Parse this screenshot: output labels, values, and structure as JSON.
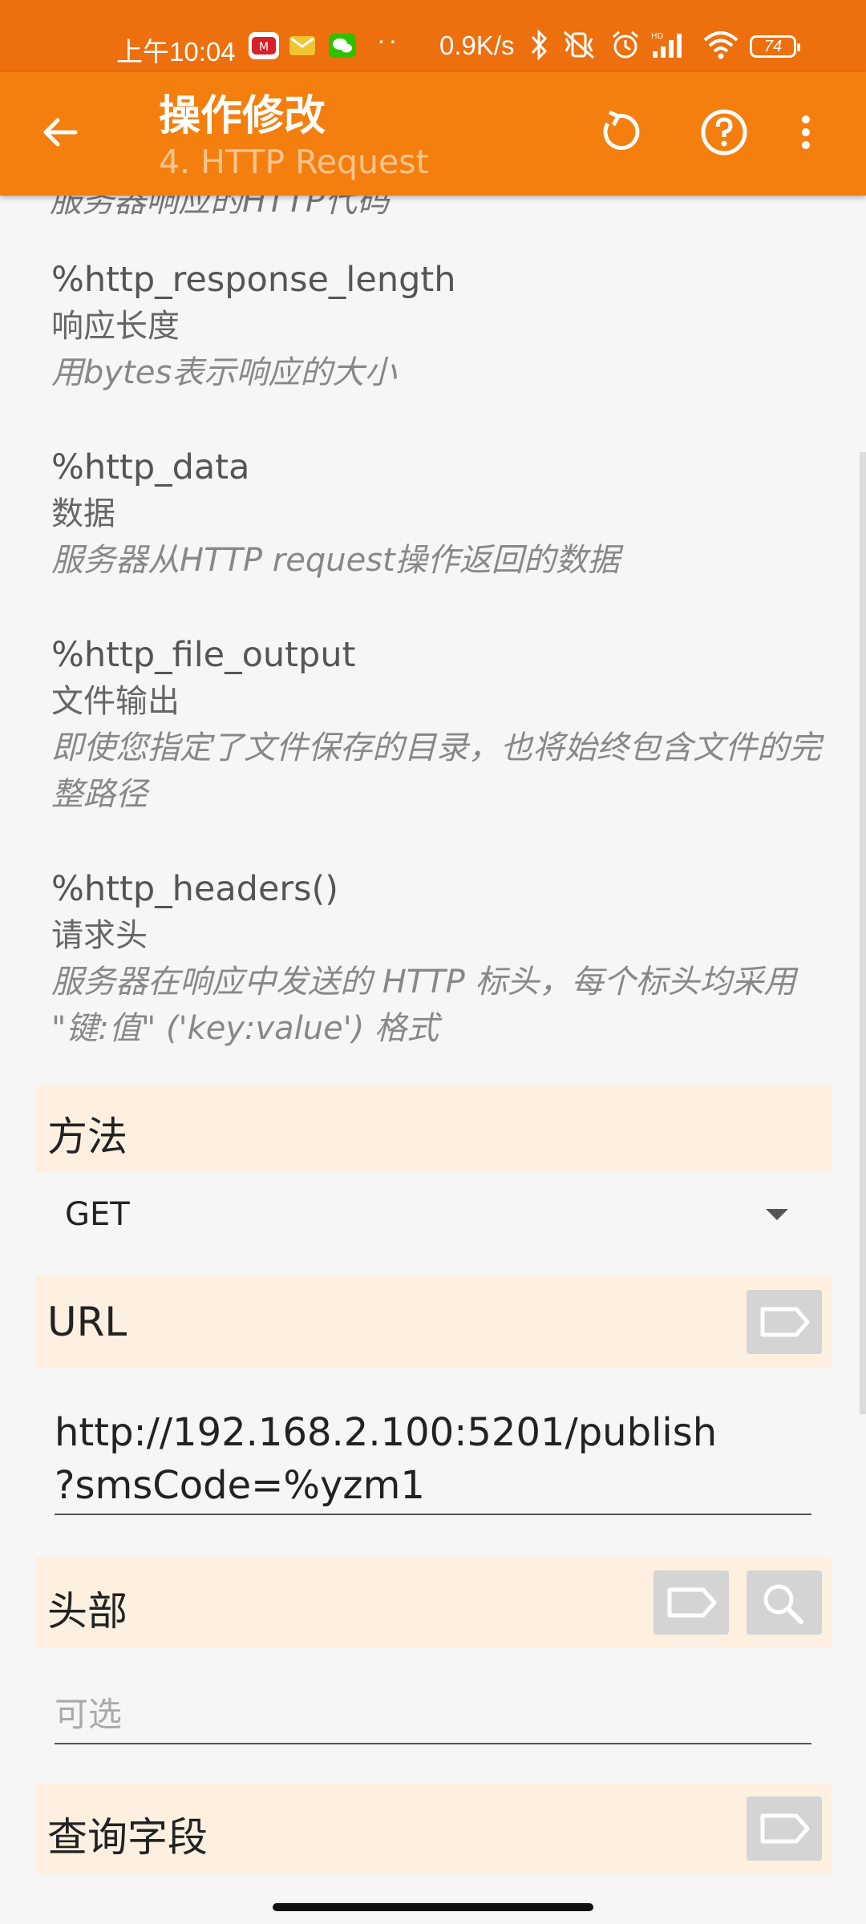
{
  "status_bar": {
    "time": "上午10:04",
    "net_speed": "0.9K/s",
    "dots": "··",
    "battery": "74"
  },
  "app_bar": {
    "title": "操作修改",
    "subtitle": "4. HTTP Request"
  },
  "variables": [
    {
      "clipped": "服务器响应的HTTP代码"
    },
    {
      "name": "%http_response_length",
      "label": "响应长度",
      "desc": "用bytes表示响应的大小"
    },
    {
      "name": "%http_data",
      "label": "数据",
      "desc": "服务器从HTTP request操作返回的数据"
    },
    {
      "name": "%http_file_output",
      "label": "文件输出",
      "desc": "即使您指定了文件保存的目录，也将始终包含文件的完整路径"
    },
    {
      "name": "%http_headers()",
      "label": "请求头",
      "desc": "服务器在响应中发送的 HTTP 标头，每个标头均采用 \"键:值\" ('key:value') 格式"
    }
  ],
  "method": {
    "label": "方法",
    "value": "GET"
  },
  "url": {
    "label": "URL",
    "value_line1": "http://192.168.2.100:5201/publish",
    "value_line2": "?smsCode=%yzm1"
  },
  "headers": {
    "label": "头部",
    "placeholder": "可选"
  },
  "query": {
    "label": "查询字段"
  },
  "colors": {
    "status_bar": "#ed6f0d",
    "app_bar": "#f57f0e",
    "section_bg": "#fdf0e0"
  },
  "icons": {
    "back": "arrow-left-icon",
    "reset": "refresh-icon",
    "help": "help-circle-icon",
    "more": "more-vert-icon",
    "tag": "tag-icon",
    "search": "search-icon"
  }
}
